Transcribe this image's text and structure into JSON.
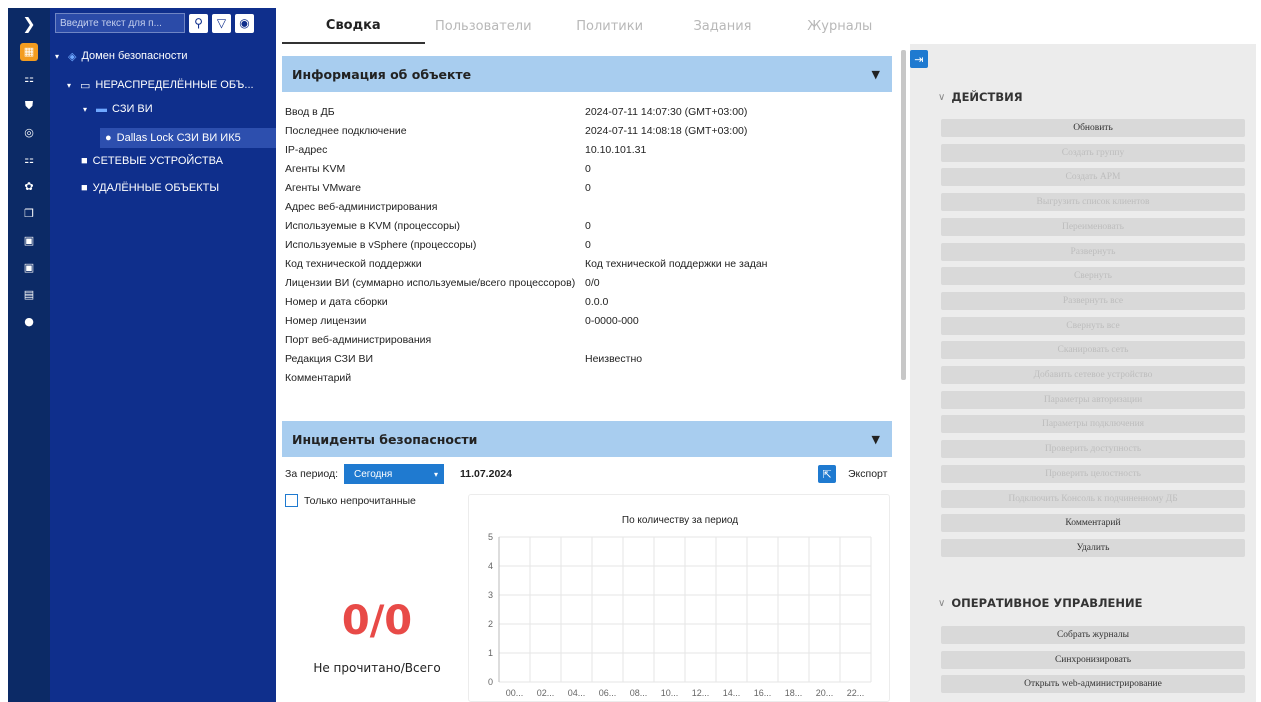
{
  "search": {
    "placeholder": "Введите текст для п..."
  },
  "tree": [
    {
      "label": "Домен безопасности",
      "level": 0,
      "type": "domain"
    },
    {
      "label": "НЕРАСПРЕДЕЛЁННЫЕ ОБЪ...",
      "level": 1,
      "type": "folder-outline"
    },
    {
      "label": "СЗИ ВИ",
      "level": 2,
      "type": "monitor"
    },
    {
      "label": "Dallas Lock СЗИ ВИ ИК5",
      "level": 3,
      "type": "agent",
      "selected": true
    },
    {
      "label": "СЕТЕВЫЕ УСТРОЙСТВА",
      "level": 1,
      "type": "folder"
    },
    {
      "label": "УДАЛЁННЫЕ ОБЪЕКТЫ",
      "level": 1,
      "type": "folder"
    }
  ],
  "tabs": [
    "Сводка",
    "Пользователи",
    "Политики",
    "Задания",
    "Журналы"
  ],
  "info": {
    "title": "Информация об объекте",
    "rows": [
      {
        "k": "Ввод в ДБ",
        "v": "2024-07-11 14:07:30 (GMT+03:00)"
      },
      {
        "k": "Последнее подключение",
        "v": "2024-07-11 14:08:18 (GMT+03:00)"
      },
      {
        "k": "IP-адрес",
        "v": "10.10.101.31"
      },
      {
        "k": "Агенты KVM",
        "v": "0"
      },
      {
        "k": "Агенты VMware",
        "v": "0"
      },
      {
        "k": "Адрес веб-администрирования",
        "v": ""
      },
      {
        "k": "Используемые в KVM (процессоры)",
        "v": "0"
      },
      {
        "k": "Используемые в vSphere (процессоры)",
        "v": "0"
      },
      {
        "k": "Код технической поддержки",
        "v": "Код технической поддержки не задан"
      },
      {
        "k": "Лицензии ВИ (суммарно используемые/всего процессоров)",
        "v": "0/0"
      },
      {
        "k": "Номер и дата сборки",
        "v": "0.0.0"
      },
      {
        "k": "Номер лицензии",
        "v": "0-0000-000"
      },
      {
        "k": "Порт веб-администрирования",
        "v": ""
      },
      {
        "k": "Редакция СЗИ ВИ",
        "v": "Неизвестно"
      },
      {
        "k": "Комментарий",
        "v": ""
      }
    ]
  },
  "incidents": {
    "title": "Инциденты безопасности",
    "period_label": "За период:",
    "period_value": "Сегодня",
    "date": "11.07.2024",
    "export": "Экспорт",
    "only_unread": "Только непрочитанные",
    "count": "0/0",
    "count_label": "Не прочитано/Всего"
  },
  "chart_data": {
    "type": "bar",
    "title": "По количеству за период",
    "categories": [
      "00...",
      "02...",
      "04...",
      "06...",
      "08...",
      "10...",
      "12...",
      "14...",
      "16...",
      "18...",
      "20...",
      "22..."
    ],
    "values": [
      0,
      0,
      0,
      0,
      0,
      0,
      0,
      0,
      0,
      0,
      0,
      0
    ],
    "ylim": [
      0,
      5
    ],
    "yticks": [
      "0",
      "1",
      "2",
      "3",
      "4",
      "5"
    ],
    "grid": true
  },
  "actions": {
    "group1": "ДЕЙСТВИЯ",
    "buttons1": [
      {
        "label": "Обновить",
        "enabled": true
      },
      {
        "label": "Создать группу",
        "enabled": false
      },
      {
        "label": "Создать АРМ",
        "enabled": false
      },
      {
        "label": "Выгрузить список клиентов",
        "enabled": false
      },
      {
        "label": "Переименовать",
        "enabled": false
      },
      {
        "label": "Развернуть",
        "enabled": false
      },
      {
        "label": "Свернуть",
        "enabled": false
      },
      {
        "label": "Развернуть все",
        "enabled": false
      },
      {
        "label": "Свернуть все",
        "enabled": false
      },
      {
        "label": "Сканировать сеть",
        "enabled": false
      },
      {
        "label": "Добавить сетевое устройство",
        "enabled": false
      },
      {
        "label": "Параметры авторизации",
        "enabled": false
      },
      {
        "label": "Параметры подключения",
        "enabled": false
      },
      {
        "label": "Проверить доступность",
        "enabled": false
      },
      {
        "label": "Проверить целостность",
        "enabled": false
      },
      {
        "label": "Подключить Консоль к подчиненному ДБ",
        "enabled": false
      },
      {
        "label": "Комментарий",
        "enabled": true
      },
      {
        "label": "Удалить",
        "enabled": true
      }
    ],
    "group2": "ОПЕРАТИВНОЕ УПРАВЛЕНИЕ",
    "buttons2": [
      {
        "label": "Собрать журналы",
        "enabled": true
      },
      {
        "label": "Синхронизировать",
        "enabled": true
      },
      {
        "label": "Открыть web-администрирование",
        "enabled": true
      }
    ]
  },
  "colors": {
    "rail": "#0c2a66",
    "tree": "#0f2f8c",
    "accent": "#1f7ad0",
    "section": "#a8cdef",
    "alert": "#e84a47"
  }
}
